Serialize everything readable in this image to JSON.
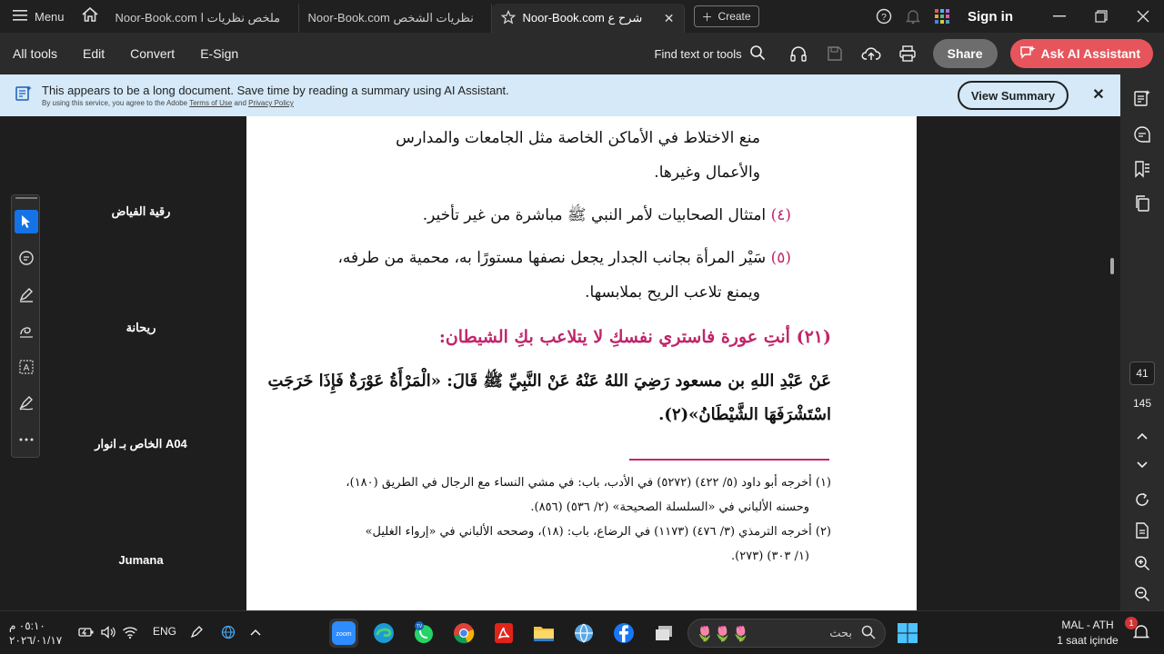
{
  "tabbar": {
    "menu_label": "Menu",
    "tabs": [
      {
        "label": "Noor-Book.com  ملخص نظريات ا"
      },
      {
        "label": "Noor-Book.com  نظريات الشخص"
      },
      {
        "label": "Noor-Book.com  شرح ع"
      }
    ],
    "create_label": "Create",
    "signin_label": "Sign in"
  },
  "toolbar": {
    "items": [
      "All tools",
      "Edit",
      "Convert",
      "E-Sign"
    ],
    "find_label": "Find text or tools",
    "share_label": "Share",
    "ai_label": "Ask AI Assistant"
  },
  "banner": {
    "message": "This appears to be a long document. Save time by reading a summary using AI Assistant.",
    "sub_prefix": "By using this service, you agree to the Adobe",
    "terms": "Terms of Use",
    "and": "and",
    "privacy": "Privacy Policy",
    "button": "View Summary",
    "close": "✕"
  },
  "pagination": {
    "current": "41",
    "total": "145"
  },
  "participants": [
    "رقية الفياض",
    "ريحانة",
    "الخاص بـ انوار A04",
    "Jumana"
  ],
  "document": {
    "lines": [
      "منع الاختلاط في الأماكن الخاصة مثل الجامعات والمدارس",
      "والأعمال وغيرها."
    ],
    "point4_num": "(٤)",
    "point4_text": "امتثال الصحابيات لأمر النبي ﷺ مباشرة من غير تأخير.",
    "point5_num": "(٥)",
    "point5_text": "سَيْر المرأة بجانب الجدار يجعل نصفها مستورًا به، محمية من طرفه،",
    "point5_cont": "ويمنع تلاعب الريح بملابسها.",
    "heading": "(٢١) أنتِ عورة فاستري نفسكِ لا يتلاعب بكِ الشيطان:",
    "hadith_1": "عَنْ عَبْدِ اللهِ بن مسعود رَضِيَ اللهُ عَنْهُ عَنْ النَّبِيِّ ﷺ قَالَ: «الْمَرْأَةُ عَوْرَةٌ فَإِذَا خَرَجَتِ",
    "hadith_2": "اسْتَشْرَفَهَا الشَّيْطَانُ»(٢).",
    "footnotes": [
      "(١) أخرجه أبو داود (٥/ ٤٢٢) (٥٢٧٢) في الأدب، باب: في مشي النساء مع الرجال في الطريق (١٨٠)،",
      "وحسنه الألباني في «السلسلة الصحيحة» (٢/ ٥٣٦) (٨٥٦).",
      "(٢) أخرجه الترمذي (٣/ ٤٧٦) (١١٧٣) في الرضاع، باب: (١٨)، وصححه الألباني في «إرواء الغليل»",
      "(١/ ٣٠٣) (٢٧٣)."
    ]
  },
  "taskbar": {
    "time": "٠٥:١٠ م",
    "date": "٢٠٢٦/٠١/١٧",
    "lang": "ENG",
    "search_placeholder": "بحث",
    "weather_line1": "MAL - ATH",
    "weather_line2": "1 saat içinde",
    "badge": "1"
  }
}
